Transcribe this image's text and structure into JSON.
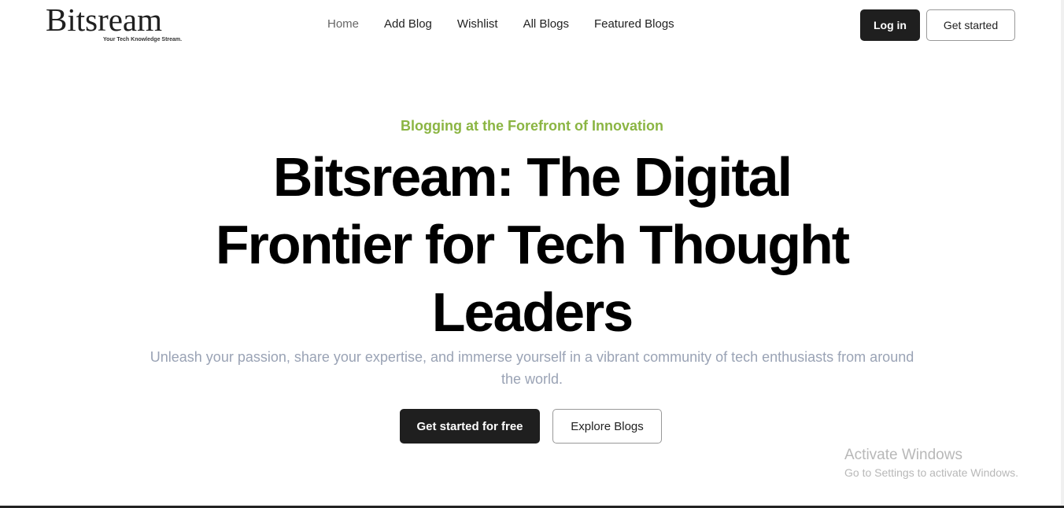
{
  "logo": {
    "name": "Bitsream",
    "tagline": "Your Tech Knowledge Stream."
  },
  "nav": [
    {
      "label": "Home"
    },
    {
      "label": "Add Blog"
    },
    {
      "label": "Wishlist"
    },
    {
      "label": "All Blogs"
    },
    {
      "label": "Featured Blogs"
    }
  ],
  "header": {
    "login": "Log in",
    "get_started": "Get started"
  },
  "hero": {
    "eyebrow": "Blogging at the Forefront of Innovation",
    "title_lines": [
      "Bitsream: The Digital",
      "Frontier for Tech Thought",
      "Leaders"
    ],
    "subtitle": "Unleash your passion, share your expertise, and immerse yourself in a vibrant community of tech enthusiasts from around the world.",
    "primary_cta": "Get started for free",
    "secondary_cta": "Explore Blogs"
  },
  "watermark": {
    "title": "Activate Windows",
    "subtitle": "Go to Settings to activate Windows."
  },
  "colors": {
    "accent": "#8bb543",
    "dark": "#1f1f1f",
    "subtitle": "#9aa3b5"
  }
}
